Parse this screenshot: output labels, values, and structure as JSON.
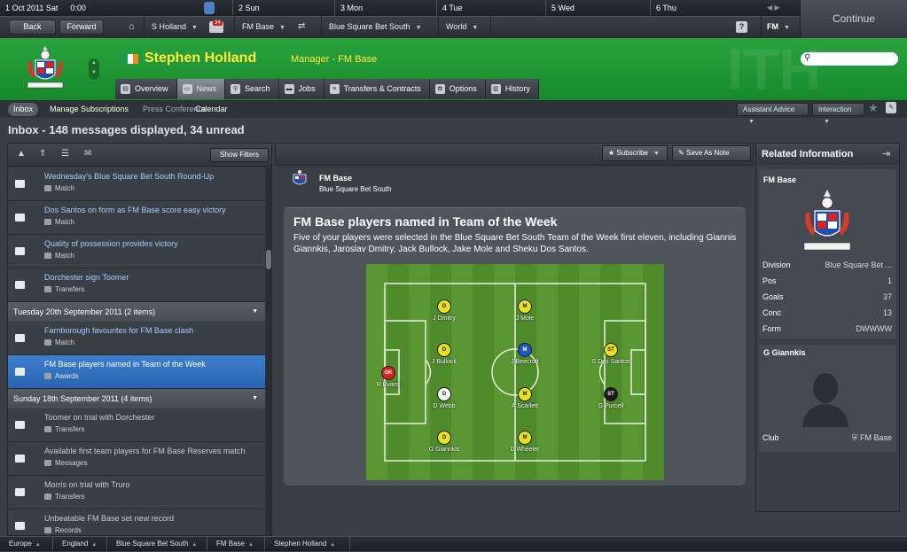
{
  "topbar": {
    "date": "1 Oct 2011 Sat",
    "time": "0:00",
    "days": [
      "2 Sun",
      "3 Mon",
      "4 Tue",
      "5 Wed",
      "6 Thu"
    ],
    "continue_label": "Continue"
  },
  "nav": {
    "back_label": "Back",
    "forward_label": "Forward",
    "manager_menu": "S Holland",
    "mail_count": "34",
    "club_menu": "FM Base",
    "league_menu": "Blue Square Bet South",
    "world_menu": "World",
    "help_label": "?",
    "fm_menu": "FM"
  },
  "header": {
    "manager_name": "Stephen Holland",
    "manager_role": "Manager - FM Base",
    "watermark": "ITH"
  },
  "tabs": [
    "Overview",
    "News",
    "Search",
    "Jobs",
    "Transfers & Contracts",
    "Options",
    "History"
  ],
  "subnav": {
    "items": [
      "Inbox",
      "Manage Subscriptions",
      "Press Conference",
      "Calendar"
    ],
    "assistant_advice": "Assistant Advice",
    "interaction": "Interaction"
  },
  "inbox_title": "Inbox - 148 messages displayed, 34 unread",
  "left": {
    "show_filters": "Show Filters",
    "messages_top": [
      {
        "title": "Wednesday's Blue Square Bet South Round-Up",
        "sub": "Match"
      },
      {
        "title": "Dos Santos on form as FM Base score easy victory",
        "sub": "Match"
      },
      {
        "title": "Quality of possession provides victory",
        "sub": "Match"
      },
      {
        "title": "Dorchester sign Toomer",
        "sub": "Transfers"
      }
    ],
    "group1": "Tuesday 20th September 2011 (2 items)",
    "messages_mid": [
      {
        "title": "Farnborough favourites for FM Base clash",
        "sub": "Match"
      },
      {
        "title": "FM Base players named in Team of the Week",
        "sub": "Awards"
      }
    ],
    "group2": "Sunday 18th September 2011 (4 items)",
    "messages_bottom": [
      {
        "title": "Toomer on trial with Dorchester",
        "sub": "Transfers"
      },
      {
        "title": "Available first team players for FM Base Reserves match",
        "sub": "Messages"
      },
      {
        "title": "Morris on trial with Truro",
        "sub": "Transfers"
      },
      {
        "title": "Unbeatable FM Base set new record",
        "sub": "Records"
      }
    ]
  },
  "center": {
    "subscribe": "Subscribe",
    "save_as_note": "Save As Note",
    "club": "FM Base",
    "league": "Blue Square Bet South",
    "article_title": "FM Base players named in Team of the Week",
    "article_body": "Five of your players were selected in the Blue Square Bet South Team of the Week first eleven, including Giannis Giannkis, Jaroslav Dmitry, Jack Bullock, Jake Mole and Sheku Dos Santos.",
    "players": [
      {
        "name": "R Evans",
        "pos": "GK",
        "color": "#d8201e",
        "text": "#ffffff"
      },
      {
        "name": "J Dmitry",
        "pos": "D",
        "color": "#e8e21a",
        "text": "#1a1a1a"
      },
      {
        "name": "J Bullock",
        "pos": "D",
        "color": "#e8e21a",
        "text": "#1a1a1a"
      },
      {
        "name": "D Webb",
        "pos": "D",
        "color": "#ffffff",
        "text": "#1a1a1a"
      },
      {
        "name": "G Giannkis",
        "pos": "D",
        "color": "#e8e21a",
        "text": "#1a1a1a"
      },
      {
        "name": "J Mole",
        "pos": "M",
        "color": "#e8e21a",
        "text": "#1a1a1a"
      },
      {
        "name": "J Beecroft",
        "pos": "M",
        "color": "#1d56c9",
        "text": "#ffffff"
      },
      {
        "name": "A Scarlett",
        "pos": "M",
        "color": "#e8e21a",
        "text": "#1a1a1a"
      },
      {
        "name": "D Wheeler",
        "pos": "M",
        "color": "#e8e21a",
        "text": "#1a1a1a"
      },
      {
        "name": "S Dos Santos",
        "pos": "ST",
        "color": "#e8e21a",
        "text": "#1a1a1a"
      },
      {
        "name": "G Purcell",
        "pos": "ST",
        "color": "#1a1a1a",
        "text": "#ffffff"
      }
    ]
  },
  "right": {
    "title": "Related Information",
    "club": "FM Base",
    "stats": [
      {
        "k": "Division",
        "v": "Blue Square Bet ..."
      },
      {
        "k": "Pos",
        "v": "1"
      },
      {
        "k": "Goals",
        "v": "37"
      },
      {
        "k": "Conc",
        "v": "13"
      },
      {
        "k": "Form",
        "v": "DWWWW"
      }
    ],
    "player": "G Giannkis",
    "club_label": "Club",
    "club_value": "FM Base"
  },
  "bottom": [
    "Europe",
    "England",
    "Blue Square Bet South",
    "FM Base",
    "Stephen Holland"
  ]
}
